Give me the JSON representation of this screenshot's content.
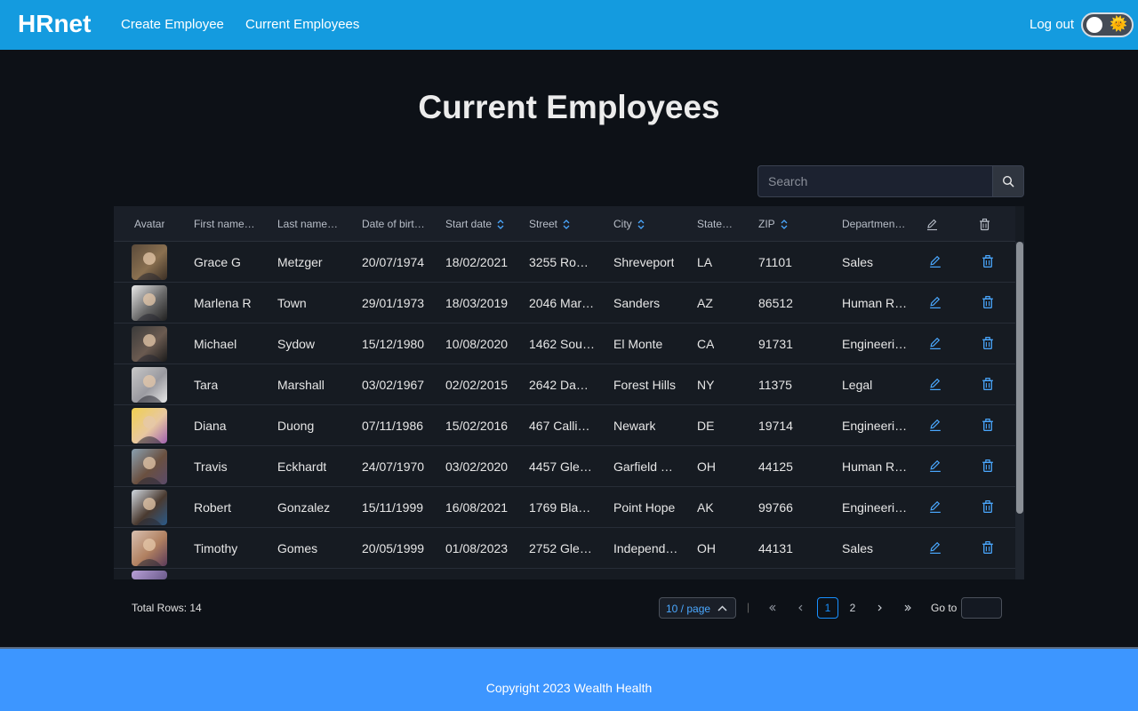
{
  "header": {
    "brand": "HRnet",
    "nav": {
      "create": "Create Employee",
      "current": "Current Employees"
    },
    "logout": "Log out",
    "theme_icon": "sun-icon",
    "theme_glyph": "🌞"
  },
  "main": {
    "title": "Current Employees",
    "search": {
      "placeholder": "Search",
      "icon": "search-icon"
    }
  },
  "table": {
    "columns": [
      "Avatar",
      "First name",
      "Last name",
      "Date of birth",
      "Start date",
      "Street",
      "City",
      "State",
      "ZIP",
      "Department"
    ],
    "column_labels_shown": [
      "Avatar",
      "First name…",
      "Last name…",
      "Date of birt…",
      "Start date",
      "Street",
      "City",
      "State…",
      "ZIP",
      "Departmen…"
    ],
    "header_icons": [
      "edit-icon",
      "delete-icon"
    ],
    "rows": [
      {
        "first": "Grace G",
        "last": "Metzger",
        "dob": "20/07/1974",
        "start": "18/02/2021",
        "street": "3255 Ro…",
        "city": "Shreveport",
        "state": "LA",
        "zip": "71101",
        "dept": "Sales"
      },
      {
        "first": "Marlena R",
        "last": "Town",
        "dob": "29/01/1973",
        "start": "18/03/2019",
        "street": "2046 Mar…",
        "city": "Sanders",
        "state": "AZ",
        "zip": "86512",
        "dept": "Human R…"
      },
      {
        "first": "Michael",
        "last": "Sydow",
        "dob": "15/12/1980",
        "start": "10/08/2020",
        "street": "1462 Sou…",
        "city": "El Monte",
        "state": "CA",
        "zip": "91731",
        "dept": "Engineeri…"
      },
      {
        "first": "Tara",
        "last": "Marshall",
        "dob": "03/02/1967",
        "start": "02/02/2015",
        "street": "2642 Da…",
        "city": "Forest Hills",
        "state": "NY",
        "zip": "11375",
        "dept": "Legal"
      },
      {
        "first": "Diana",
        "last": "Duong",
        "dob": "07/11/1986",
        "start": "15/02/2016",
        "street": "467 Calli…",
        "city": "Newark",
        "state": "DE",
        "zip": "19714",
        "dept": "Engineeri…"
      },
      {
        "first": "Travis",
        "last": "Eckhardt",
        "dob": "24/07/1970",
        "start": "03/02/2020",
        "street": "4457 Gle…",
        "city": "Garfield …",
        "state": "OH",
        "zip": "44125",
        "dept": "Human R…"
      },
      {
        "first": "Robert",
        "last": "Gonzalez",
        "dob": "15/11/1999",
        "start": "16/08/2021",
        "street": "1769 Bla…",
        "city": "Point Hope",
        "state": "AK",
        "zip": "99766",
        "dept": "Engineeri…"
      },
      {
        "first": "Timothy",
        "last": "Gomes",
        "dob": "20/05/1999",
        "start": "01/08/2023",
        "street": "2752 Gle…",
        "city": "Independ…",
        "state": "OH",
        "zip": "44131",
        "dept": "Sales"
      }
    ]
  },
  "pagination": {
    "total_label": "Total Rows: 14",
    "page_size": "10 / page",
    "pages": [
      "1",
      "2"
    ],
    "current_page": "1",
    "goto_label": "Go to",
    "separator": "|"
  },
  "footer": {
    "copyright": "Copyright 2023 Wealth Health"
  },
  "colors": {
    "header_bg": "#149bdf",
    "footer_bg": "#3d96ff",
    "accent": "#1890ff",
    "page_bg": "#0d1117"
  }
}
